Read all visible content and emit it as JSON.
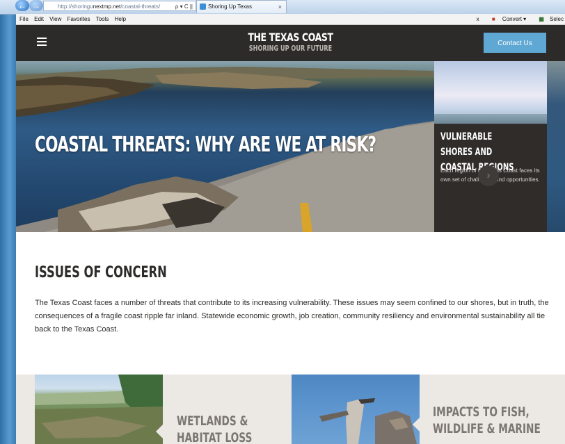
{
  "browser": {
    "url_prefix": "http://shoringu",
    "url_domain": "nextmp.net",
    "url_suffix": "/coastal-threats/",
    "addr_controls": "ρ ▾ C ||",
    "tab_title": "Shoring Up Texas",
    "tab_close": "×",
    "menu": [
      "File",
      "Edit",
      "View",
      "Favorites",
      "Tools",
      "Help"
    ],
    "menu_right": {
      "close": "x",
      "convert": "Convert",
      "select": "Selec"
    }
  },
  "header": {
    "title": "THE TEXAS COAST",
    "subtitle": "SHORING UP OUR FUTURE",
    "contact_label": "Contact Us"
  },
  "hero": {
    "title": "COASTAL THREATS: WHY ARE WE AT RISK?",
    "card": {
      "title": "VULNERABLE SHORES AND COASTAL REGIONS",
      "text": "Each region of the Texas Coast faces its own set of challenges and opportunities.",
      "arrow": "›"
    }
  },
  "issues": {
    "title": "ISSUES OF CONCERN",
    "text": "The Texas Coast faces a number of threats that contribute to its increasing vulnerability. These issues may seem confined to our shores, but in truth, the consequences of a fragile coast ripple far inland. Statewide economic growth, job creation, community resiliency and environmental sustainability all tie back to the Texas Coast."
  },
  "cards": [
    {
      "title_line1": "WETLANDS &",
      "title_line2": "HABITAT LOSS"
    },
    {
      "title_line1": "IMPACTS TO FISH,",
      "title_line2": "WILDLIFE & MARINE"
    }
  ]
}
